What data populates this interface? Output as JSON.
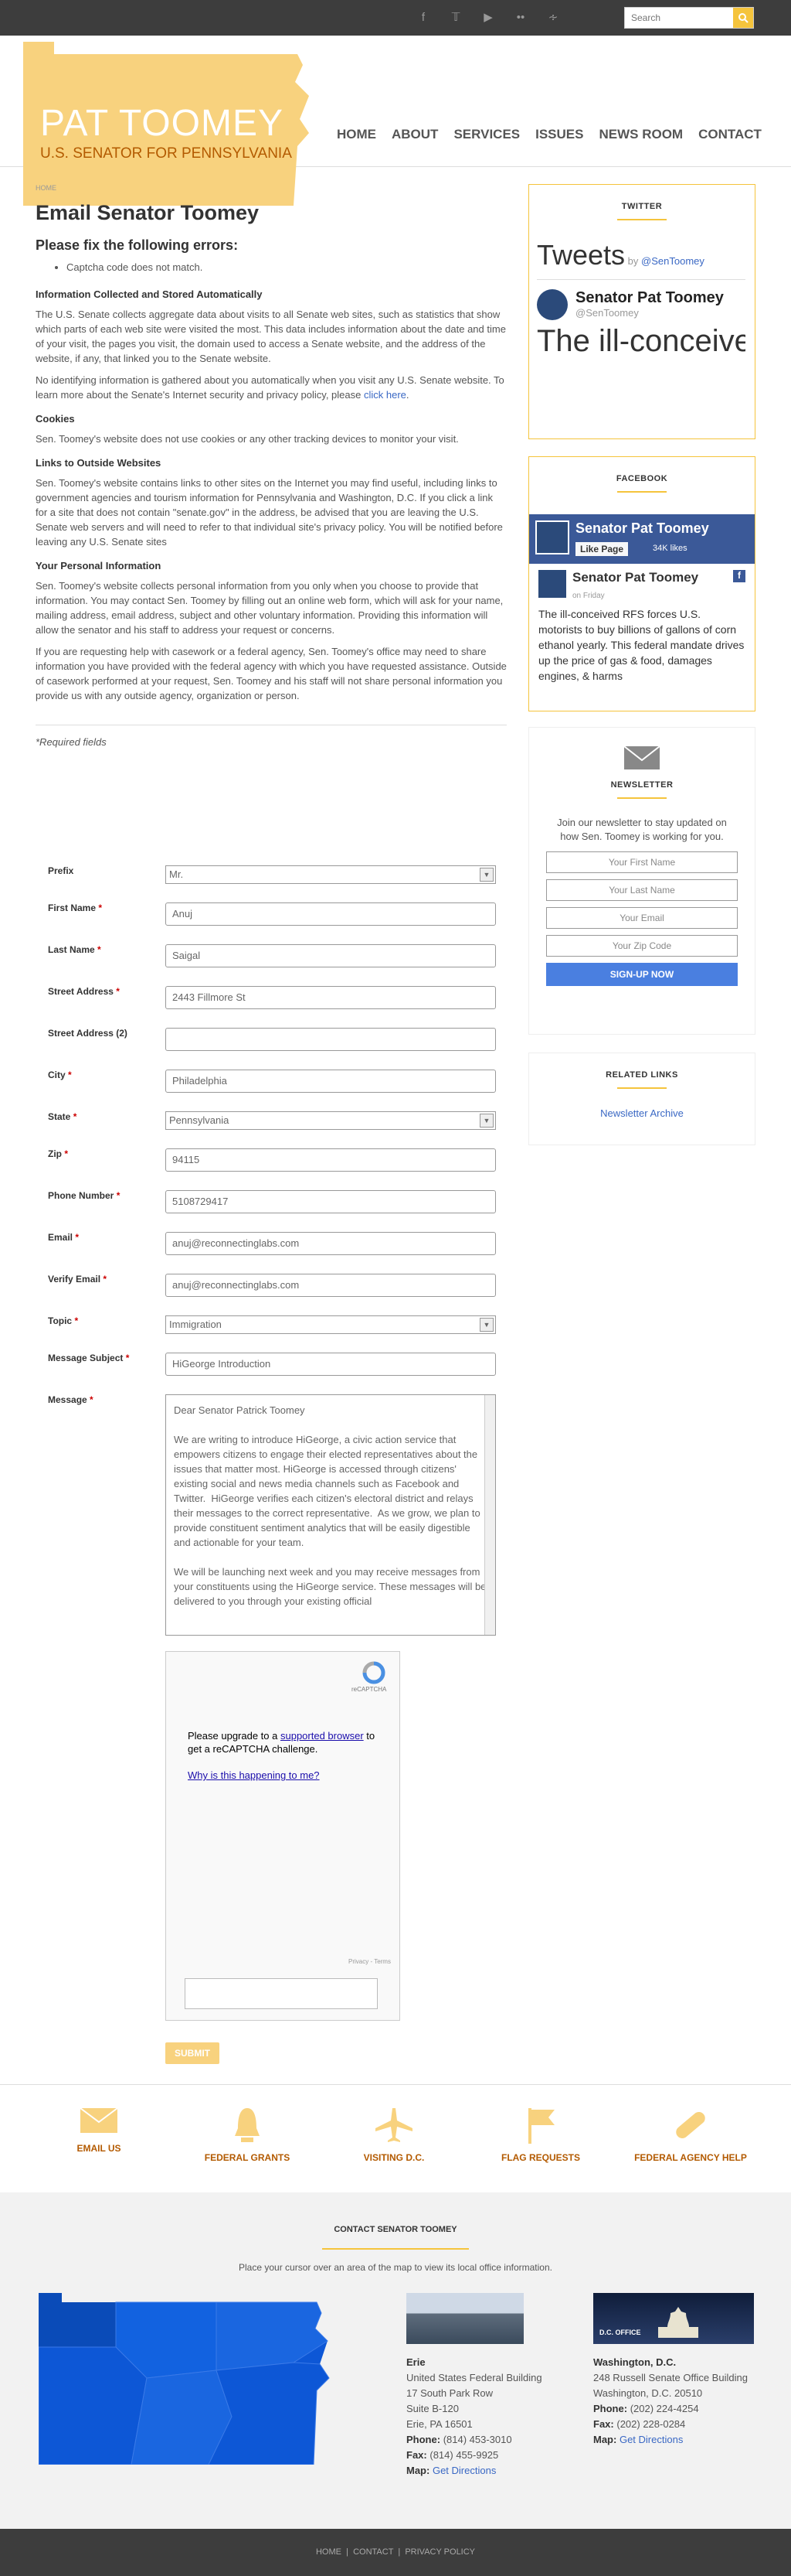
{
  "search": {
    "placeholder": "Search"
  },
  "logo": {
    "name": "PAT TOOMEY",
    "subtitle": "U.S. SENATOR FOR PENNSYLVANIA"
  },
  "nav": [
    "HOME",
    "ABOUT",
    "SERVICES",
    "ISSUES",
    "NEWS ROOM",
    "CONTACT"
  ],
  "breadcrumb": "HOME",
  "page_title": "Email Senator Toomey",
  "errors_title": "Please fix the following errors:",
  "errors": [
    "Captcha code does not match."
  ],
  "sections": [
    {
      "h": "Information Collected and Stored Automatically",
      "p": [
        "The U.S. Senate collects aggregate data about visits to all Senate web sites, such as statistics that show which parts of each web site were visited the most. This data includes information about the date and time of your visit, the pages you visit, the domain used to access a Senate website, and the address of the website, if any, that linked you to the Senate website.",
        "No identifying information is gathered about you automatically when you visit any U.S. Senate website. To learn more about the Senate's Internet security and privacy policy, please "
      ]
    },
    {
      "h": "Cookies",
      "p": [
        "Sen. Toomey's website does not use cookies or any other tracking devices to monitor your visit."
      ]
    },
    {
      "h": "Links to Outside Websites",
      "p": [
        "Sen. Toomey's website contains links to other sites on the Internet you may find useful, including links to government agencies and tourism information for Pennsylvania and Washington, D.C. If you click a link for a site that does not contain \"senate.gov\" in the address, be advised that you are leaving the U.S. Senate web servers and will need to refer to that individual site's privacy policy. You will be notified before leaving any U.S. Senate sites"
      ]
    },
    {
      "h": "Your Personal Information",
      "p": [
        "Sen. Toomey's website collects personal information from you only when you choose to provide that information. You may contact Sen. Toomey by filling out an online web form, which will ask for your name, mailing address, email address, subject and other voluntary information. Providing this information will allow the senator and his staff to address your request or concerns.",
        "If you are requesting help with casework or a federal agency, Sen. Toomey's office may need to share information you have provided with the federal agency with which you have requested assistance. Outside of casework performed at your request, Sen. Toomey and his staff will not share personal information you provide us with any outside agency, organization or person."
      ]
    }
  ],
  "click_here": "click here",
  "required_note": "*Required fields",
  "form": {
    "prefix": {
      "label": "Prefix",
      "value": "Mr."
    },
    "first": {
      "label": "First Name",
      "value": "Anuj"
    },
    "last": {
      "label": "Last Name",
      "value": "Saigal"
    },
    "street": {
      "label": "Street Address",
      "value": "2443 Fillmore St"
    },
    "street2": {
      "label": "Street Address (2)",
      "value": ""
    },
    "city": {
      "label": "City",
      "value": "Philadelphia"
    },
    "state": {
      "label": "State",
      "value": "Pennsylvania"
    },
    "zip": {
      "label": "Zip",
      "value": "94115"
    },
    "phone": {
      "label": "Phone Number",
      "value": "5108729417"
    },
    "email": {
      "label": "Email",
      "value": "anuj@reconnectinglabs.com"
    },
    "verify": {
      "label": "Verify Email",
      "value": "anuj@reconnectinglabs.com"
    },
    "topic": {
      "label": "Topic",
      "value": "Immigration"
    },
    "subject": {
      "label": "Message Subject",
      "value": "HiGeorge Introduction"
    },
    "message": {
      "label": "Message",
      "value": "Dear Senator Patrick Toomey\n\nWe are writing to introduce HiGeorge, a civic action service that empowers citizens to engage their elected representatives about the issues that matter most. HiGeorge is accessed through citizens' existing social and news media channels such as Facebook and Twitter.  HiGeorge verifies each citizen's electoral district and relays their messages to the correct representative.  As we grow, we plan to provide constituent sentiment analytics that will be easily digestible and actionable for your team.\n\nWe will be launching next week and you may receive messages from your constituents using the HiGeorge service. These messages will be delivered to you through your existing official"
    },
    "captcha_text": "Please upgrade to a ",
    "captcha_link": "supported browser",
    "captcha_text2": " to get a reCAPTCHA challenge.",
    "captcha_why": "Why is this happening to me?",
    "captcha_logo": "reCAPTCHA",
    "captcha_footer": "Privacy - Terms",
    "submit": "SUBMIT"
  },
  "twitter": {
    "title": "TWITTER",
    "tweets": "Tweets",
    "by": "by",
    "handle": "@SenToomey",
    "name": "Senator Pat Toomey",
    "tweet_text": "The ill-conceived RFS forces U.S. motorists to buy billions of gallons"
  },
  "facebook": {
    "title": "FACEBOOK",
    "page_name": "Senator Pat Toomey",
    "like": "Like Page",
    "likes_count": "34K likes",
    "post_time": "on Friday",
    "post": "The ill-conceived RFS forces U.S. motorists to buy billions of gallons of corn ethanol yearly. This federal mandate drives up the price of gas & food, damages engines, & harms"
  },
  "newsletter": {
    "title": "NEWSLETTER",
    "text": "Join our newsletter to stay updated on how Sen. Toomey is working for you.",
    "first": "Your First Name",
    "last": "Your Last Name",
    "email": "Your Email",
    "zip": "Your Zip Code",
    "button": "SIGN-UP NOW"
  },
  "related": {
    "title": "RELATED LINKS",
    "link": "Newsletter Archive"
  },
  "quick": [
    "EMAIL US",
    "FEDERAL GRANTS",
    "VISITING D.C.",
    "FLAG REQUESTS",
    "FEDERAL AGENCY HELP"
  ],
  "contact": {
    "title": "CONTACT SENATOR TOOMEY",
    "hint": "Place your cursor over an area of the map to view its local office information.",
    "erie": {
      "city": "Erie",
      "l1": "United States Federal Building",
      "l2": "17 South Park Row",
      "l3": "Suite B-120",
      "l4": "Erie, PA 16501",
      "phone_l": "Phone:",
      "phone": "(814) 453-3010",
      "fax_l": "Fax:",
      "fax": "(814) 455-9925",
      "map_l": "Map:",
      "map": "Get Directions"
    },
    "dc": {
      "city": "Washington, D.C.",
      "label": "D.C. OFFICE",
      "l1": "248 Russell Senate Office Building",
      "l2": "Washington, D.C. 20510",
      "phone_l": "Phone:",
      "phone": "(202) 224-4254",
      "fax_l": "Fax:",
      "fax": "(202) 228-0284",
      "map_l": "Map:",
      "map": "Get Directions"
    }
  },
  "footer": {
    "home": "HOME",
    "contact": "CONTACT",
    "privacy": "PRIVACY POLICY",
    "sep": "|"
  },
  "colors": {
    "accent": "#f5c43c",
    "link": "#3a68c4",
    "map": "#0d57d6"
  }
}
